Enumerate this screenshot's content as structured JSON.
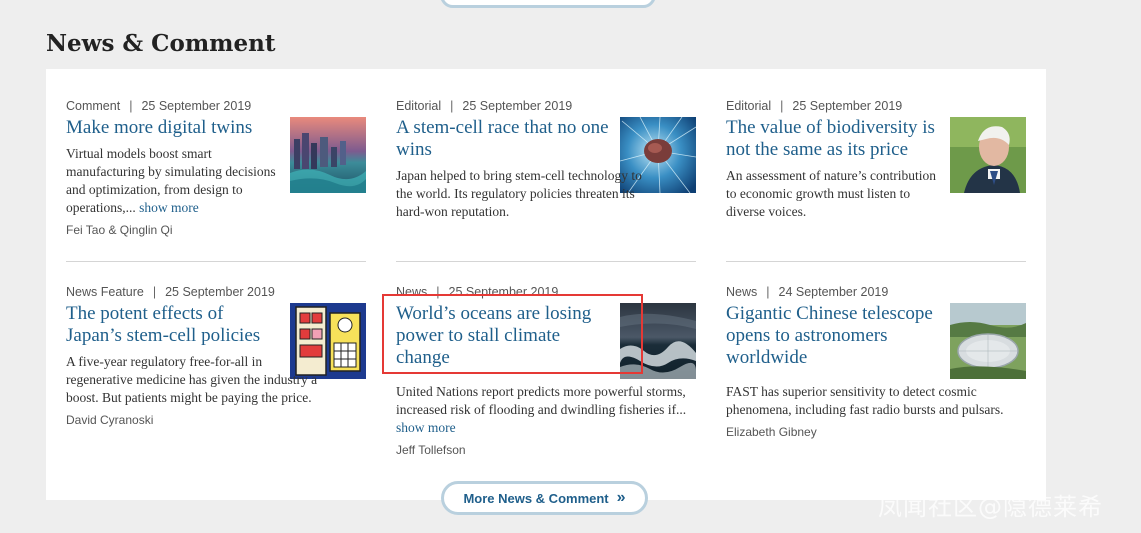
{
  "section": {
    "title": "News & Comment"
  },
  "articles": [
    {
      "type": "Comment",
      "date": "25 September 2019",
      "headline": "Make more digital twins",
      "summary": "Virtual models boost smart manufacturing by simulating decisions and optimization, from design to operations,...",
      "show_more": "show more",
      "author": "Fei Tao & Qinglin Qi",
      "image": "city-digital-twin"
    },
    {
      "type": "Editorial",
      "date": "25 September 2019",
      "headline": "A stem-cell race that no one wins",
      "summary": "Japan helped to bring stem-cell technology to the world. Its regulatory policies threaten its hard-won reputation.",
      "image": "cell-under-microscope"
    },
    {
      "type": "Editorial",
      "date": "25 September 2019",
      "headline": "The value of biodiversity is not the same as its price",
      "summary": "An assessment of nature’s contribution to economic growth must listen to diverse voices.",
      "image": "portrait-elderly-man"
    },
    {
      "type": "News Feature",
      "date": "25 September 2019",
      "headline": "The potent effects of Japan’s stem-cell policies",
      "summary": "A five-year regulatory free-for-all in regenerative medicine has given the industry a boost. But patients might be paying the price.",
      "author": "David Cyranoski",
      "image": "illustration-cabinets"
    },
    {
      "type": "News",
      "date": "25 September 2019",
      "headline": "World’s oceans are losing power to stall climate change",
      "summary": "United Nations report predicts more powerful storms, increased risk of flooding and dwindling fisheries if...",
      "show_more": "show more",
      "author": "Jeff Tollefson",
      "image": "stormy-ocean"
    },
    {
      "type": "News",
      "date": "24 September 2019",
      "headline": "Gigantic Chinese telescope opens to astronomers worldwide",
      "summary": "FAST has superior sensitivity to detect cosmic phenomena, including fast radio bursts and pulsars.",
      "author": "Elizabeth Gibney",
      "image": "radio-telescope-dish"
    }
  ],
  "more_button": {
    "label": "More News & Comment",
    "icon": "double-chevron-right-icon"
  },
  "watermark": "凤闻社区@隐德莱希",
  "colors": {
    "link": "#1f5f8b",
    "highlight": "#e53935",
    "button_border": "#b9d0de"
  }
}
